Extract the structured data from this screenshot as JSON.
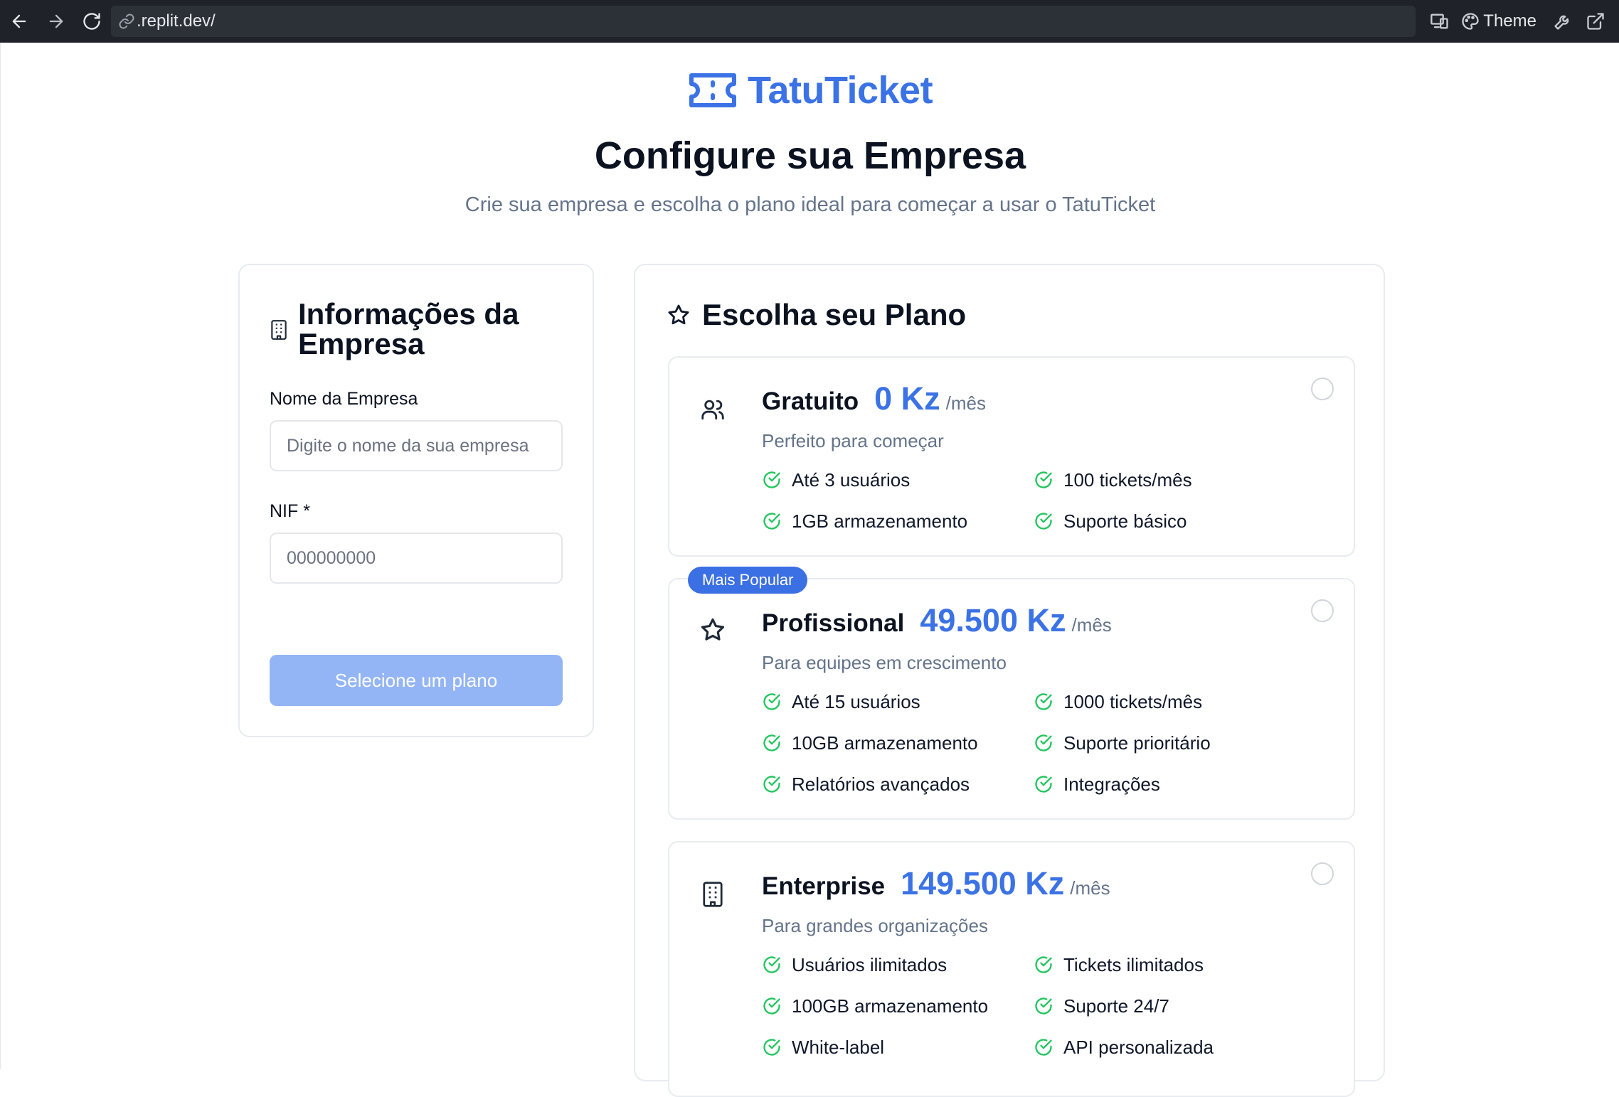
{
  "browser": {
    "url": ".replit.dev/",
    "theme_label": "Theme"
  },
  "brand": {
    "name": "TatuTicket"
  },
  "header": {
    "title": "Configure sua Empresa",
    "subtitle": "Crie sua empresa e escolha o plano ideal para começar a usar o TatuTicket"
  },
  "company_form": {
    "title": "Informações da Empresa",
    "name_label": "Nome da Empresa",
    "name_placeholder": "Digite o nome da sua empresa",
    "nif_label": "NIF *",
    "nif_placeholder": "000000000",
    "submit_label": "Selecione um plano"
  },
  "plans_section": {
    "title": "Escolha seu Plano",
    "plans": [
      {
        "icon": "users-icon",
        "name": "Gratuito",
        "price": "0 Kz",
        "period": "/mês",
        "description": "Perfeito para começar",
        "features": [
          "Até 3 usuários",
          "100 tickets/mês",
          "1GB armazenamento",
          "Suporte básico"
        ]
      },
      {
        "icon": "star-icon",
        "badge": "Mais Popular",
        "name": "Profissional",
        "price": "49.500 Kz",
        "period": "/mês",
        "description": "Para equipes em crescimento",
        "features": [
          "Até 15 usuários",
          "1000 tickets/mês",
          "10GB armazenamento",
          "Suporte prioritário",
          "Relatórios avançados",
          "Integrações"
        ]
      },
      {
        "icon": "building-icon",
        "name": "Enterprise",
        "price": "149.500 Kz",
        "period": "/mês",
        "description": "Para grandes organizações",
        "features": [
          "Usuários ilimitados",
          "Tickets ilimitados",
          "100GB armazenamento",
          "Suporte 24/7",
          "White-label",
          "API personalizada"
        ]
      }
    ]
  },
  "colors": {
    "accent": "#3b72e6",
    "check": "#22c55e",
    "muted": "#64748b",
    "disabled_button": "#94b5f5"
  }
}
